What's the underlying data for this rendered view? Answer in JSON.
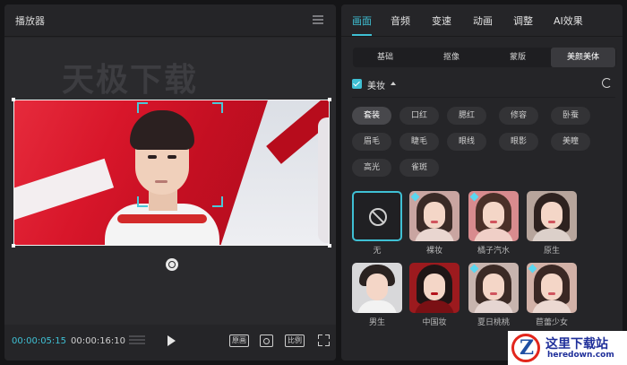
{
  "player": {
    "title": "播放器",
    "watermark": "天极下载",
    "time_current": "00:00:05:15",
    "time_total": "00:00:16:10",
    "original_label": "原画",
    "ratio_label": "比例"
  },
  "tabs": [
    {
      "label": "画面",
      "active": true
    },
    {
      "label": "音频",
      "active": false
    },
    {
      "label": "变速",
      "active": false
    },
    {
      "label": "动画",
      "active": false
    },
    {
      "label": "调整",
      "active": false
    },
    {
      "label": "AI效果",
      "active": false
    }
  ],
  "subtabs": [
    {
      "label": "基础",
      "active": false
    },
    {
      "label": "抠像",
      "active": false
    },
    {
      "label": "蒙版",
      "active": false
    },
    {
      "label": "美颜美体",
      "active": true
    }
  ],
  "section": {
    "title": "美妆",
    "checked": true
  },
  "chips": [
    {
      "label": "套装",
      "active": true
    },
    {
      "label": "口红",
      "active": false
    },
    {
      "label": "腮红",
      "active": false
    },
    {
      "label": "修容",
      "active": false
    },
    {
      "label": "卧蚕",
      "active": false
    },
    {
      "label": "眉毛",
      "active": false
    },
    {
      "label": "睫毛",
      "active": false
    },
    {
      "label": "眼线",
      "active": false
    },
    {
      "label": "眼影",
      "active": false
    },
    {
      "label": "美瞳",
      "active": false
    },
    {
      "label": "高光",
      "active": false
    },
    {
      "label": "雀斑",
      "active": false
    }
  ],
  "presets": [
    {
      "label": "无",
      "selected": true
    },
    {
      "label": "裸妆",
      "selected": false
    },
    {
      "label": "橘子汽水",
      "selected": false
    },
    {
      "label": "原生",
      "selected": false
    },
    {
      "label": "男生",
      "selected": false
    },
    {
      "label": "中国妆",
      "selected": false
    },
    {
      "label": "夏日桃桃",
      "selected": false
    },
    {
      "label": "苣蕾少女",
      "selected": false
    }
  ],
  "badge": {
    "cn": "这里下载站",
    "en": "heredown.com"
  },
  "colors": {
    "accent": "#3fc0d4",
    "panel": "#252528",
    "background": "#151517"
  }
}
